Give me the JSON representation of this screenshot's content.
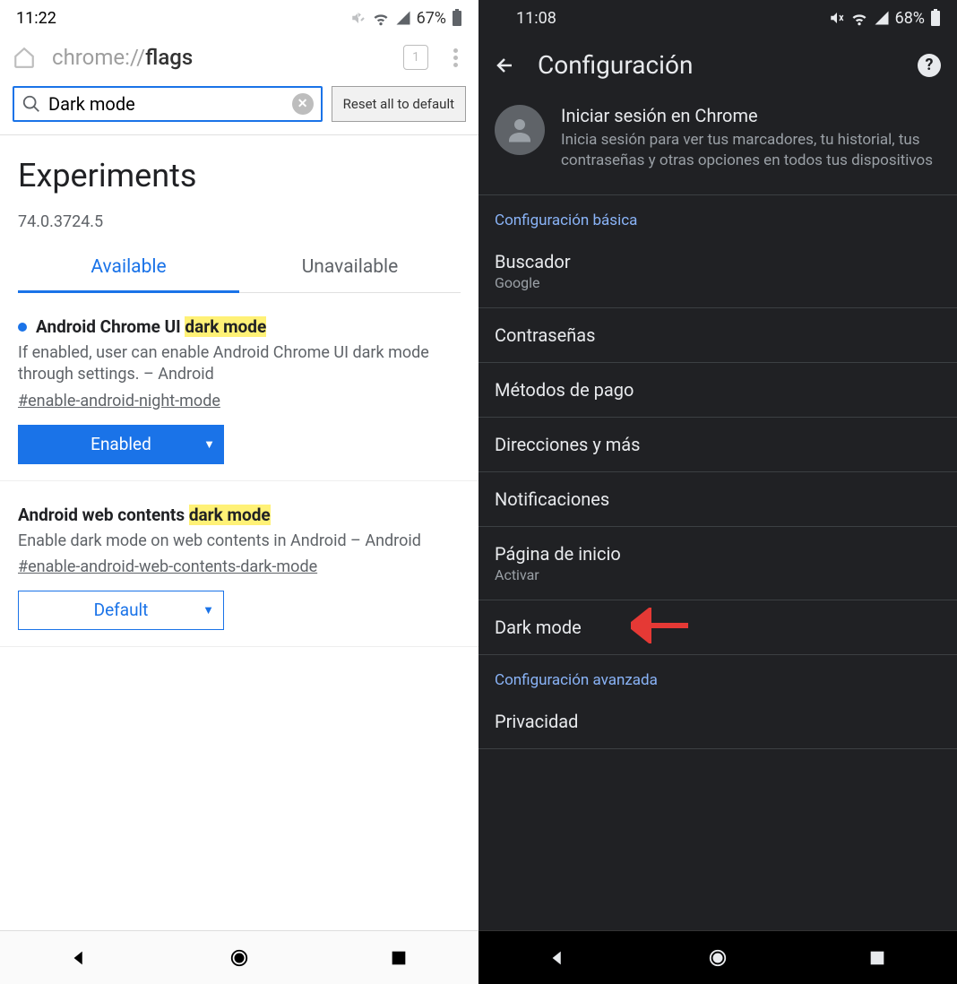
{
  "left": {
    "status": {
      "time": "11:22",
      "battery": "67%"
    },
    "address": {
      "prefix": "chrome://",
      "path": "flags",
      "tab_count": "1"
    },
    "search": {
      "value": "Dark mode",
      "reset_label": "Reset all to default"
    },
    "experiments": {
      "title": "Experiments",
      "version": "74.0.3724.5",
      "tabs": {
        "available": "Available",
        "unavailable": "Unavailable"
      }
    },
    "flags": [
      {
        "name_prefix": "Android Chrome UI ",
        "name_highlight": "dark mode",
        "desc": "If enabled, user can enable Android Chrome UI dark mode through settings. – Android",
        "id": "#enable-android-night-mode",
        "value": "Enabled",
        "style": "enabled",
        "has_dot": true
      },
      {
        "name_prefix": "Android web contents ",
        "name_highlight": "dark mode",
        "desc": "Enable dark mode on web contents in Android – Android",
        "id": "#enable-android-web-contents-dark-mode",
        "value": "Default",
        "style": "default",
        "has_dot": false
      }
    ]
  },
  "right": {
    "status": {
      "time": "11:08",
      "battery": "68%"
    },
    "header": {
      "title": "Configuración"
    },
    "signin": {
      "title": "Iniciar sesión en Chrome",
      "sub": "Inicia sesión para ver tus marcadores, tu historial, tus contraseñas y otras opciones en todos tus dispositivos"
    },
    "section_basic": "Configuración básica",
    "items": [
      {
        "t1": "Buscador",
        "t2": "Google"
      },
      {
        "t1": "Contraseñas"
      },
      {
        "t1": "Métodos de pago"
      },
      {
        "t1": "Direcciones y más"
      },
      {
        "t1": "Notificaciones"
      },
      {
        "t1": "Página de inicio",
        "t2": "Activar"
      },
      {
        "t1": "Dark mode",
        "arrow": true
      }
    ],
    "section_adv": "Configuración avanzada",
    "adv_items": [
      {
        "t1": "Privacidad"
      }
    ]
  }
}
